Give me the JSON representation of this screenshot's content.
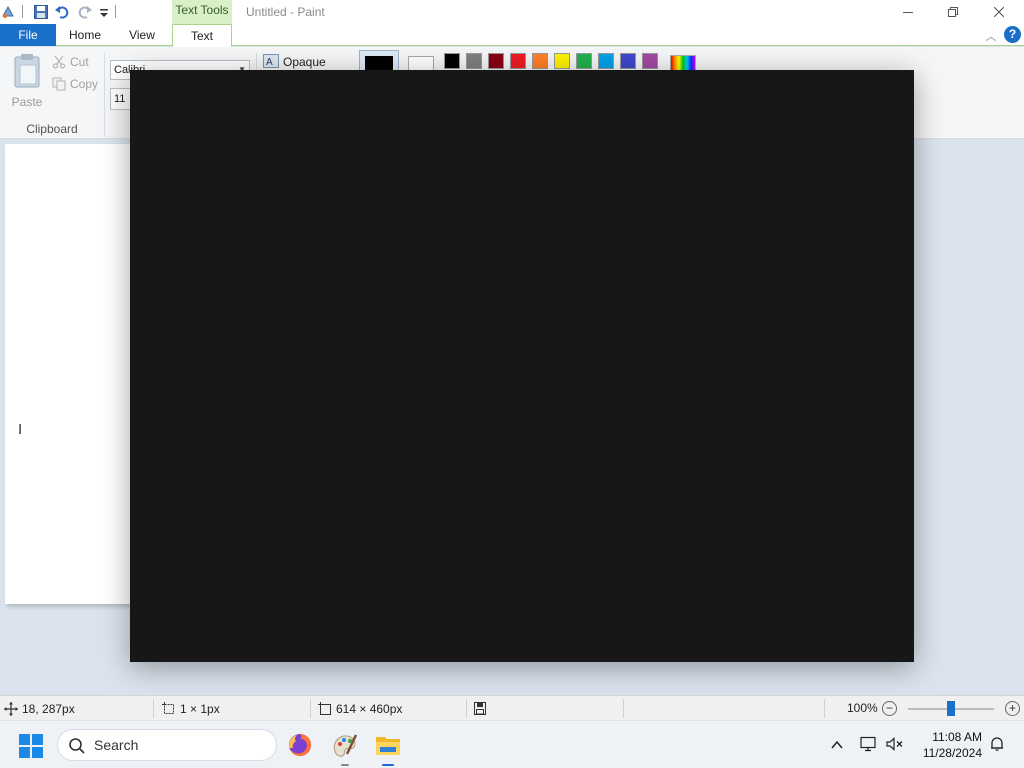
{
  "titlebar": {
    "window_title": "Untitled - Paint",
    "context_tab_header": "Text Tools",
    "window_controls": [
      "minimize",
      "restore",
      "close"
    ]
  },
  "ribbon": {
    "tabs": [
      {
        "id": "file",
        "label": "File"
      },
      {
        "id": "home",
        "label": "Home"
      },
      {
        "id": "view",
        "label": "View"
      },
      {
        "id": "text",
        "label": "Text",
        "selected": true
      }
    ],
    "clipboard": {
      "paste_label": "Paste",
      "cut_label": "Cut",
      "copy_label": "Copy",
      "group_label": "Clipboard"
    },
    "font": {
      "family": "Calibri",
      "size": "11"
    },
    "background": {
      "opaque_label": "Opaque"
    },
    "colors": {
      "color1": "#000000",
      "color2": "#ffffff",
      "palette": [
        "#000000",
        "#7f7f7f",
        "#880015",
        "#ed1c24",
        "#ff7f27",
        "#fff200",
        "#22b14c",
        "#00a2e8",
        "#3f48cc",
        "#a349a4"
      ]
    }
  },
  "status": {
    "cursor_position": "18, 287px",
    "selection_size": "1 × 1px",
    "image_size": "614 × 460px",
    "zoom": "100%",
    "zoom_fraction": 0.5
  },
  "taskbar": {
    "search_placeholder": "Search",
    "apps": [
      "firefox",
      "paint",
      "file-explorer"
    ],
    "time": "11:08 AM",
    "date": "11/28/2024"
  },
  "accent_color": "#1a6fc9",
  "overlay_color": "#171717"
}
